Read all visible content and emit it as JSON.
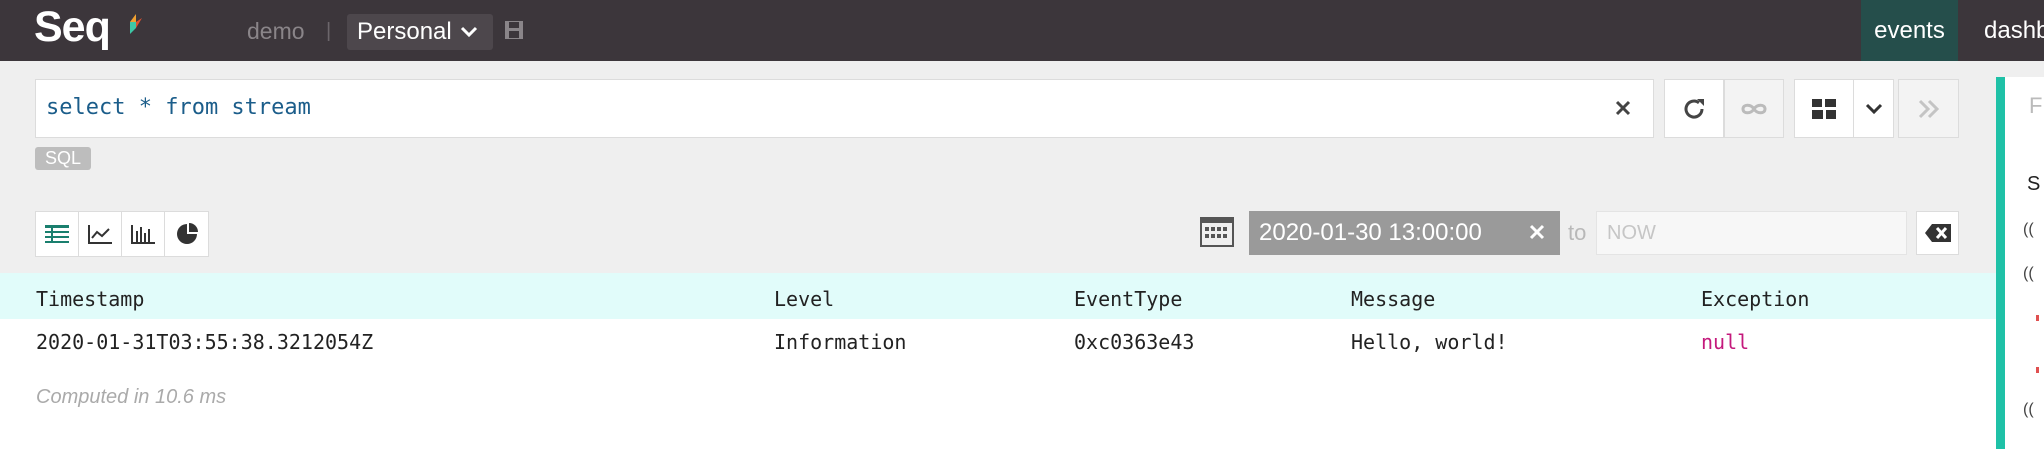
{
  "app": {
    "logo": "Seq"
  },
  "header": {
    "workspace_label": "demo",
    "separator": "|",
    "workspace_selected": "Personal",
    "nav": {
      "events": "events",
      "dashboards": "dashb"
    }
  },
  "query": {
    "text": "select * from stream",
    "language_badge": "SQL"
  },
  "date_range": {
    "from": "2020-01-30 13:00:00",
    "to_label": "to",
    "to_placeholder": "NOW"
  },
  "table": {
    "columns": [
      "Timestamp",
      "Level",
      "EventType",
      "Message",
      "Exception"
    ],
    "rows": [
      [
        "2020-01-31T03:55:38.3212054Z",
        "Information",
        "0xc0363e43",
        "Hello, world!",
        "null"
      ]
    ]
  },
  "status": {
    "computed": "Computed in 10.6 ms"
  },
  "colors": {
    "topbar": "#3c363b",
    "nav_active": "#254e4b",
    "accent": "#1fc1a7",
    "header_row": "#e1fcfa",
    "null_value": "#c4197c",
    "query_text": "#1b5d8a"
  }
}
